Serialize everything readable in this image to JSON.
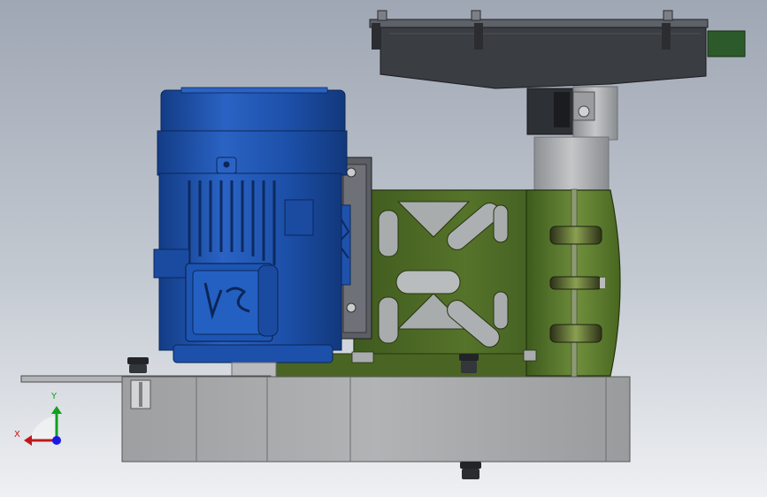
{
  "viewport": {
    "background_top": "#9fa7b4",
    "background_bottom": "#eef0f3"
  },
  "model": {
    "parts": [
      "gearbox-housing",
      "gearbox-output-shaft",
      "support-column",
      "drive-bracket-assembly",
      "electric-motor",
      "motor-flange",
      "base-frame",
      "base-foot-plate",
      "fastener-bolts"
    ],
    "colors": {
      "motor": "#1e52ad",
      "bracket": "#4e6a26",
      "gearbox": "#3a3d42",
      "base": "#a4a6a8",
      "shaft": "#a9acae"
    }
  },
  "triad": {
    "x_label": "X",
    "y_label": "Y",
    "x_color": "#c01818",
    "y_color": "#10a020",
    "z_color": "#1a1ae6"
  }
}
